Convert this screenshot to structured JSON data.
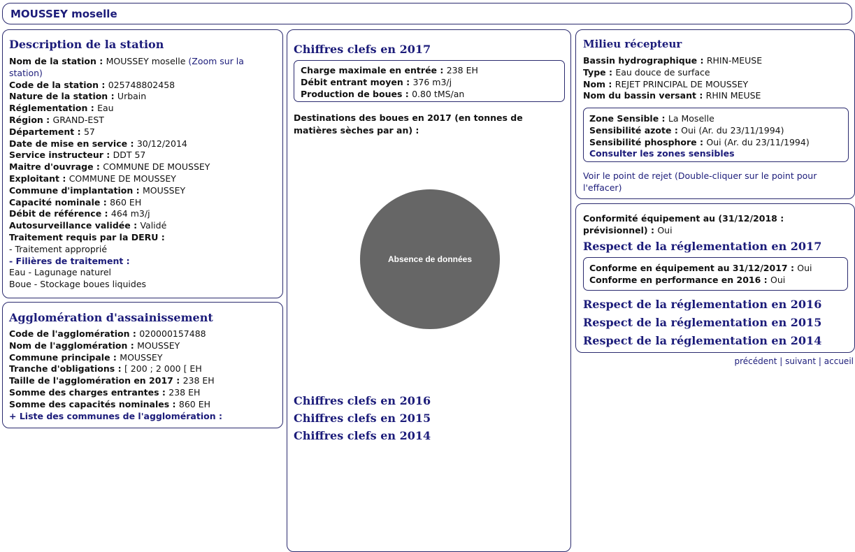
{
  "header": {
    "title": "MOUSSEY moselle"
  },
  "station": {
    "heading": "Description de la station",
    "nom_label": "Nom de la station : ",
    "nom_value": "MOUSSEY moselle ",
    "zoom_link": "(Zoom sur la",
    "zoom_link2": "station)",
    "rows": [
      {
        "label": "Code de la station : ",
        "value": "025748802458"
      },
      {
        "label": "Nature de la station : ",
        "value": "Urbain"
      },
      {
        "label": "Réglementation : ",
        "value": "Eau"
      },
      {
        "label": "Région : ",
        "value": "GRAND-EST"
      },
      {
        "label": "Département : ",
        "value": "57"
      },
      {
        "label": "Date de mise en service : ",
        "value": "30/12/2014"
      },
      {
        "label": "Service instructeur : ",
        "value": "DDT 57"
      },
      {
        "label": "Maitre d'ouvrage : ",
        "value": "COMMUNE DE MOUSSEY"
      },
      {
        "label": "Exploitant : ",
        "value": "COMMUNE DE MOUSSEY"
      },
      {
        "label": "Commune d'implantation : ",
        "value": "MOUSSEY"
      },
      {
        "label": "Capacité nominale : ",
        "value": "860 EH"
      },
      {
        "label": "Débit de référence : ",
        "value": "464 m3/j"
      },
      {
        "label": "Autosurveillance validée : ",
        "value": "Validé"
      }
    ],
    "deru_label": "Traitement requis par la DERU :",
    "deru_value": "- Traitement approprié",
    "filieres_label": "- Filières de traitement :",
    "filiere_eau": "Eau - Lagunage naturel",
    "filiere_boue": "Boue - Stockage boues liquides"
  },
  "agglomeration": {
    "heading": "Agglomération d'assainissement",
    "rows": [
      {
        "label": "Code de l'agglomération : ",
        "value": "020000157488"
      },
      {
        "label": "Nom de l'agglomération : ",
        "value": "MOUSSEY"
      },
      {
        "label": "Commune principale : ",
        "value": "MOUSSEY"
      },
      {
        "label": "Tranche d'obligations : ",
        "value": "[ 200 ; 2 000 [ EH"
      },
      {
        "label": "Taille de l'agglomération en 2017 : ",
        "value": "238 EH"
      },
      {
        "label": "Somme des charges entrantes : ",
        "value": "238 EH"
      },
      {
        "label": "Somme des capacités nominales : ",
        "value": "860 EH"
      }
    ],
    "communes_link": "+ Liste des communes de l'agglomération :"
  },
  "chiffres": {
    "heading": "Chiffres clefs en 2017",
    "rows": [
      {
        "label": "Charge maximale en entrée  : ",
        "value": "238 EH"
      },
      {
        "label": "Débit entrant moyen : ",
        "value": "376 m3/j"
      },
      {
        "label": "Production de boues : ",
        "value": "0.80 tMS/an"
      }
    ],
    "destinations_line1": "Destinations des boues en 2017 (en tonnes de",
    "destinations_line2": "matières sèches par an) :",
    "pie_empty_label": "Absence de données",
    "pie_color": "#666666",
    "other_years": [
      "Chiffres clefs en 2016",
      "Chiffres clefs en 2015",
      "Chiffres clefs en 2014"
    ]
  },
  "milieu": {
    "heading": "Milieu récepteur",
    "rows": [
      {
        "label": "Bassin hydrographique : ",
        "value": "RHIN-MEUSE"
      },
      {
        "label": "Type : ",
        "value": "Eau douce de surface"
      },
      {
        "label": "Nom : ",
        "value": "REJET PRINCIPAL DE MOUSSEY"
      },
      {
        "label": "Nom du bassin versant : ",
        "value": "RHIN MEUSE"
      }
    ],
    "zone": [
      {
        "label": "Zone Sensible : ",
        "value": "La Moselle"
      },
      {
        "label": "Sensibilité azote : ",
        "value": "Oui (Ar. du 23/11/1994)"
      },
      {
        "label": "Sensibilité phosphore : ",
        "value": "Oui (Ar. du 23/11/1994)"
      }
    ],
    "zones_link": "Consulter les zones sensibles",
    "rejet_line1": "Voir le point de rejet (Double-cliquer sur le point pour",
    "rejet_line2": "l'effacer)"
  },
  "conformite": {
    "line1": "Conformité équipement au (31/12/2018 :",
    "line2_label": "prévisionnel) : ",
    "line2_value": "Oui",
    "respect_2017": "Respect de la réglementation en 2017",
    "rows": [
      {
        "label": "Conforme en équipement au 31/12/2017 : ",
        "value": "Oui"
      },
      {
        "label": "Conforme en performance en 2016 : ",
        "value": "Oui"
      }
    ],
    "respect_other": [
      "Respect de la réglementation en 2016",
      "Respect de la réglementation en 2015",
      "Respect de la réglementation en 2014"
    ]
  },
  "nav": {
    "prev": "précédent",
    "sep": " | ",
    "next": "suivant",
    "home": "accueil"
  }
}
